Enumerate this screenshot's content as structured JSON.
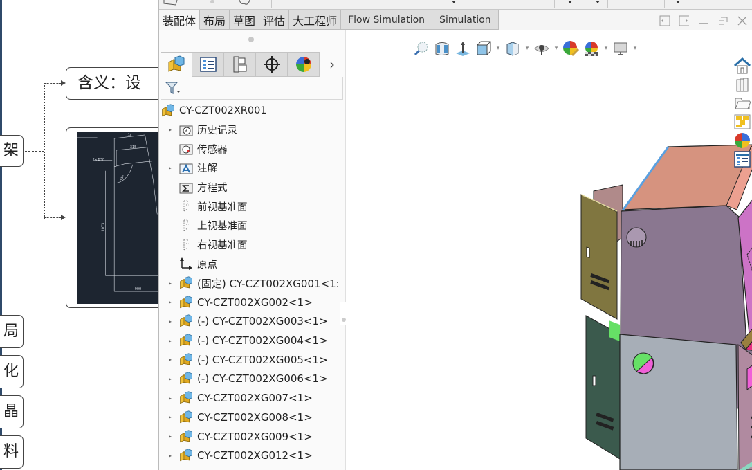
{
  "mindmap": {
    "root_node_fragment": "架",
    "meaning_node": "含义：设",
    "drawing_node": {
      "dims": [
        "1ℓ",
        "315",
        "2×Φ30",
        "45°",
        "1073",
        "900"
      ]
    },
    "branch_fragments": [
      "局",
      "化",
      "晶",
      "料"
    ]
  },
  "command_tabs": [
    {
      "label": "装配体",
      "active": true
    },
    {
      "label": "布局",
      "active": false
    },
    {
      "label": "草图",
      "active": false
    },
    {
      "label": "评估",
      "active": false
    },
    {
      "label": "大工程师",
      "active": false
    },
    {
      "label": "Flow Simulation",
      "active": false
    },
    {
      "label": "Simulation",
      "active": false
    }
  ],
  "window_controls": {
    "left_arrow": "◂",
    "right_arrow": "▸",
    "minimize": "_",
    "restore": "⧉",
    "close": "✕"
  },
  "feature_manager": {
    "tabs": [
      {
        "name": "featuremanager-tab",
        "icon": "assembly-icon",
        "active": true
      },
      {
        "name": "propertymanager-tab",
        "icon": "property-list-icon",
        "active": false
      },
      {
        "name": "configurationmanager-tab",
        "icon": "configuration-tree-icon",
        "active": false
      },
      {
        "name": "dimxpertmanager-tab",
        "icon": "crosshair-icon",
        "active": false
      },
      {
        "name": "displaymanager-tab",
        "icon": "appearance-ball-icon",
        "active": false
      }
    ],
    "more_label": "›",
    "filter_icon": "filter-icon",
    "tree": [
      {
        "label": "CY-CZT002XR001",
        "icon": "assembly",
        "expander": false,
        "kind": "root"
      },
      {
        "label": "历史记录",
        "icon": "history",
        "expander": true,
        "kind": "folder"
      },
      {
        "label": "传感器",
        "icon": "sensor",
        "expander": false,
        "kind": "folder"
      },
      {
        "label": "注解",
        "icon": "annotation",
        "expander": true,
        "kind": "folder"
      },
      {
        "label": "方程式",
        "icon": "equation",
        "expander": false,
        "kind": "folder"
      },
      {
        "label": "前视基准面",
        "icon": "plane",
        "expander": false,
        "kind": "plane"
      },
      {
        "label": "上视基准面",
        "icon": "plane",
        "expander": false,
        "kind": "plane"
      },
      {
        "label": "右视基准面",
        "icon": "plane",
        "expander": false,
        "kind": "plane"
      },
      {
        "label": "原点",
        "icon": "origin",
        "expander": false,
        "kind": "origin"
      },
      {
        "label": "(固定) CY-CZT002XG001<1:",
        "icon": "assembly",
        "expander": true,
        "kind": "comp"
      },
      {
        "label": "CY-CZT002XG002<1>",
        "icon": "assembly",
        "expander": true,
        "kind": "comp"
      },
      {
        "label": "(-) CY-CZT002XG003<1>",
        "icon": "assembly",
        "expander": true,
        "kind": "comp"
      },
      {
        "label": "(-) CY-CZT002XG004<1>",
        "icon": "assembly",
        "expander": true,
        "kind": "comp"
      },
      {
        "label": "(-) CY-CZT002XG005<1>",
        "icon": "assembly",
        "expander": true,
        "kind": "comp"
      },
      {
        "label": "(-) CY-CZT002XG006<1>",
        "icon": "assembly",
        "expander": true,
        "kind": "comp"
      },
      {
        "label": "CY-CZT002XG007<1>",
        "icon": "assembly",
        "expander": true,
        "kind": "comp"
      },
      {
        "label": "CY-CZT002XG008<1>",
        "icon": "assembly",
        "expander": true,
        "kind": "comp"
      },
      {
        "label": "CY-CZT002XG009<1>",
        "icon": "assembly",
        "expander": true,
        "kind": "comp"
      },
      {
        "label": "CY-CZT002XG012<1>",
        "icon": "assembly",
        "expander": true,
        "kind": "comp"
      }
    ]
  },
  "heads_up_toolbar": [
    {
      "name": "zoom-to-fit",
      "dropdown": false
    },
    {
      "name": "section-view",
      "dropdown": false
    },
    {
      "name": "dynamic-annotation",
      "dropdown": false
    },
    {
      "name": "view-orientation",
      "dropdown": true
    },
    {
      "name": "display-style",
      "dropdown": true
    },
    {
      "name": "hide-show-items",
      "dropdown": true
    },
    {
      "name": "edit-appearance",
      "dropdown": false
    },
    {
      "name": "apply-scene",
      "dropdown": true
    },
    {
      "name": "view-settings",
      "dropdown": true
    }
  ],
  "task_pane": [
    "solidworks-resources",
    "design-library",
    "file-explorer",
    "view-palette",
    "appearances-scenes",
    "custom-properties"
  ],
  "colors": {
    "top_panel": "#d6937f",
    "side_panel": "#8a7790",
    "screen_panel": "#cc73c6",
    "desk_panel": "#e62e80",
    "lower_front": "#a7aeb7",
    "left_door": "#807640",
    "dark_door": "#3b5a4d",
    "back_panel": "#b08a8a"
  }
}
